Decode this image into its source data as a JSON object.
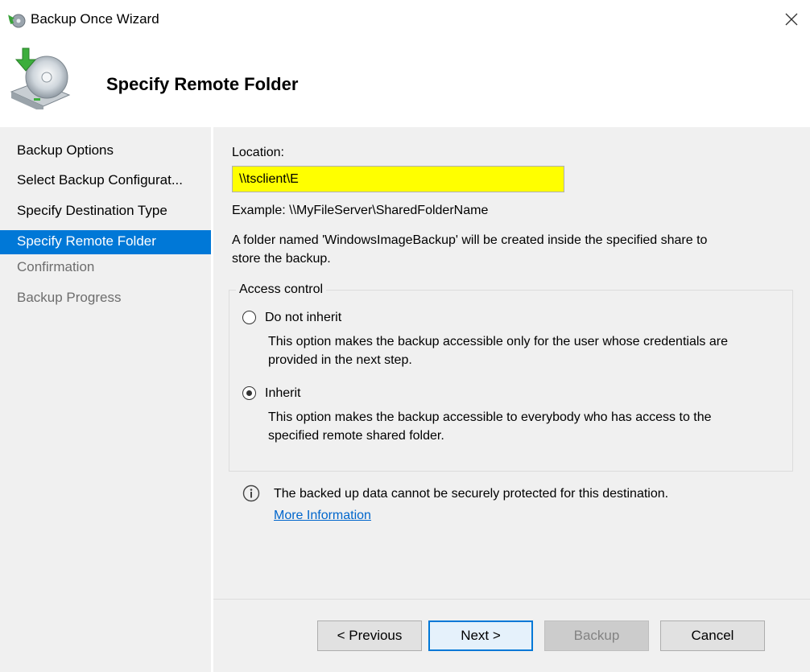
{
  "window": {
    "title": "Backup Once Wizard",
    "close_icon": "close-icon"
  },
  "header": {
    "title": "Specify Remote Folder",
    "icon": "backup-disk-icon"
  },
  "sidebar": {
    "items": [
      {
        "label": "Backup Options",
        "state": "normal"
      },
      {
        "label": "Select Backup Configurat...",
        "state": "normal"
      },
      {
        "label": "Specify Destination Type",
        "state": "normal"
      },
      {
        "label": "Specify Remote Folder",
        "state": "selected"
      },
      {
        "label": "Confirmation",
        "state": "disabled"
      },
      {
        "label": "Backup Progress",
        "state": "disabled"
      }
    ]
  },
  "main": {
    "location_label": "Location:",
    "location_value": "\\\\tsclient\\E",
    "example_text": "Example: \\\\MyFileServer\\SharedFolderName",
    "folder_note_line1": "A folder named 'WindowsImageBackup' will be created inside the specified share to",
    "folder_note_line2": "store the backup.",
    "access_control": {
      "legend": "Access control",
      "options": [
        {
          "label": "Do not inherit",
          "selected": false,
          "desc_line1": "This option makes the backup accessible only for the user whose credentials are",
          "desc_line2": "provided in the next step."
        },
        {
          "label": "Inherit",
          "selected": true,
          "desc_line1": "This option makes the backup accessible to everybody who has access to the",
          "desc_line2": "specified remote shared folder."
        }
      ]
    },
    "info_text": "The backed up data cannot be securely protected for this destination.",
    "more_info_link": "More Information"
  },
  "buttons": {
    "previous": "< Previous",
    "next": "Next >",
    "backup": "Backup",
    "cancel": "Cancel"
  },
  "colors": {
    "selection": "#0078d7",
    "highlight_input": "#ffff00",
    "link": "#0066cc"
  }
}
